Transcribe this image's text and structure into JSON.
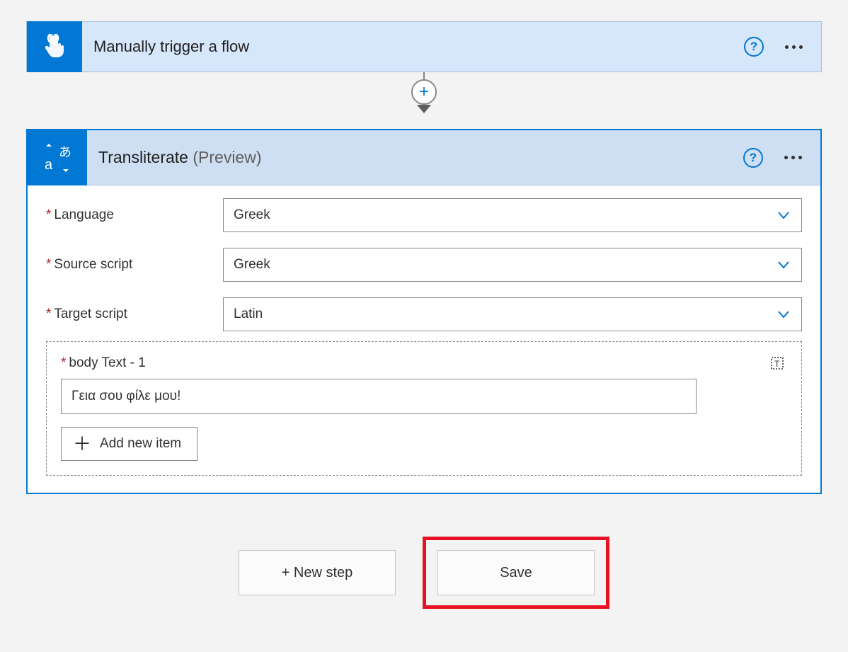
{
  "trigger": {
    "title": "Manually trigger a flow"
  },
  "action": {
    "title": "Transliterate",
    "preview_suffix": "(Preview)",
    "fields": {
      "language": {
        "label": "Language",
        "value": "Greek"
      },
      "source_script": {
        "label": "Source script",
        "value": "Greek"
      },
      "target_script": {
        "label": "Target script",
        "value": "Latin"
      }
    },
    "body_item": {
      "label": "body Text - 1",
      "value": "Γεια σου φίλε μου!"
    },
    "add_item_label": "Add new item"
  },
  "bottom": {
    "new_step": "+ New step",
    "save": "Save"
  }
}
